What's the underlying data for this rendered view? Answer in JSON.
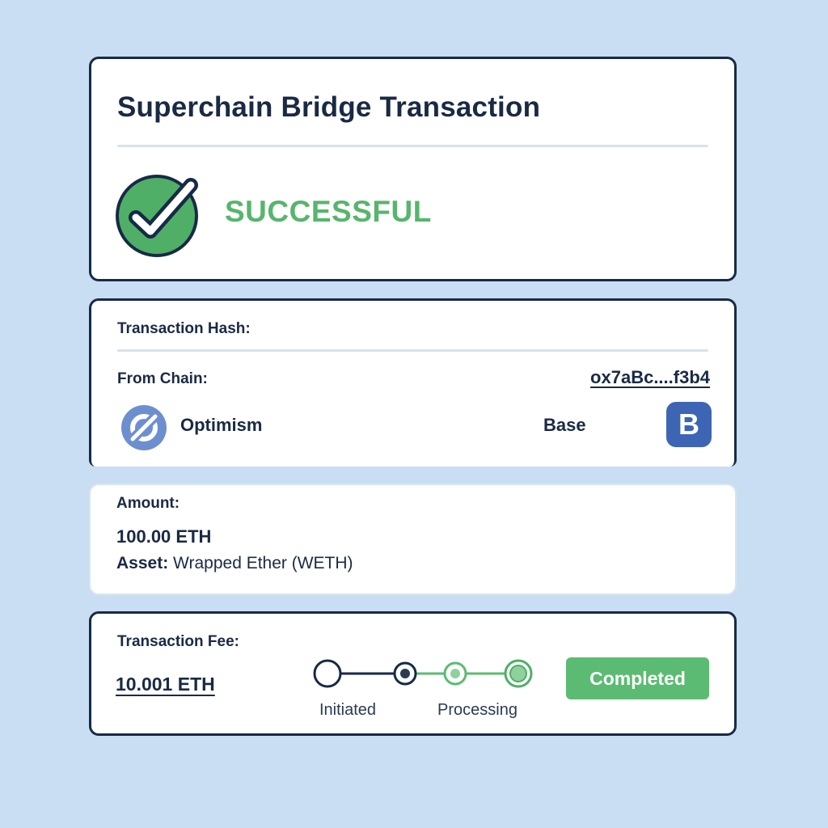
{
  "header": {
    "title": "Superchain Bridge Transaction",
    "status": "SUCCESSFUL"
  },
  "transaction": {
    "hash_label": "Transaction Hash:",
    "from_label": "From Chain:",
    "hash_value": "ox7aBc....f3b4",
    "from_chain": {
      "name": "Optimism",
      "icon": "optimism-logo-icon"
    },
    "to_chain": {
      "name": "Base",
      "icon": "base-logo-icon",
      "icon_letter": "B"
    }
  },
  "amount": {
    "label": "Amount:",
    "value": "100.00 ETH",
    "asset_label": "Asset:",
    "asset_value": "Wrapped Ether (WETH)"
  },
  "fee": {
    "label": "Transaction Fee:",
    "value": "10.001 ETH",
    "steps": [
      "Initiated",
      "Processing"
    ],
    "status_button": "Completed"
  },
  "colors": {
    "background": "#c9def2",
    "navy": "#172a46",
    "success_green": "#57b56d",
    "base_blue": "#3e64b4",
    "optimism_blue": "#6d8fd0"
  }
}
